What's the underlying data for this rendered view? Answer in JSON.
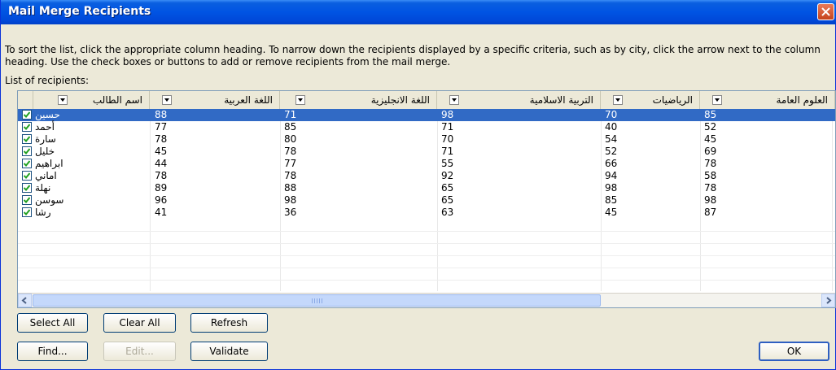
{
  "window": {
    "title": "Mail Merge Recipients"
  },
  "instructions": "To sort the list, click the appropriate column heading.  To narrow down the recipients displayed by a specific criteria, such as by city, click the arrow next to the column heading.  Use the check boxes or buttons to add or remove recipients from the mail merge.",
  "list_label": "List of recipients:",
  "columns": [
    "اسم الطالب",
    "اللغة العربية",
    "اللغة الانجليزية",
    "التربية الاسلامية",
    "الرياضيات",
    "العلوم العامة"
  ],
  "rows": [
    {
      "checked": true,
      "name": "حسين",
      "arabic": "88",
      "english": "71",
      "islamic": "98",
      "math": "70",
      "science": "85"
    },
    {
      "checked": true,
      "name": "أحمد",
      "arabic": "77",
      "english": "85",
      "islamic": "71",
      "math": "40",
      "science": "52"
    },
    {
      "checked": true,
      "name": "سارة",
      "arabic": "78",
      "english": "80",
      "islamic": "70",
      "math": "54",
      "science": "45"
    },
    {
      "checked": true,
      "name": "خليل",
      "arabic": "45",
      "english": "78",
      "islamic": "71",
      "math": "52",
      "science": "69"
    },
    {
      "checked": true,
      "name": "ابراهيم",
      "arabic": "44",
      "english": "77",
      "islamic": "55",
      "math": "66",
      "science": "78"
    },
    {
      "checked": true,
      "name": "اماني",
      "arabic": "78",
      "english": "78",
      "islamic": "92",
      "math": "94",
      "science": "58"
    },
    {
      "checked": true,
      "name": "نهلة",
      "arabic": "89",
      "english": "88",
      "islamic": "65",
      "math": "98",
      "science": "78"
    },
    {
      "checked": true,
      "name": "سوسن",
      "arabic": "96",
      "english": "98",
      "islamic": "65",
      "math": "85",
      "science": "98"
    },
    {
      "checked": true,
      "name": "رشا",
      "arabic": "41",
      "english": "36",
      "islamic": "63",
      "math": "45",
      "science": "87"
    }
  ],
  "buttons": {
    "select_all": "Select All",
    "clear_all": "Clear All",
    "refresh": "Refresh",
    "find": "Find...",
    "edit": "Edit...",
    "validate": "Validate",
    "ok": "OK"
  },
  "colors": {
    "titlebar": "#0054e3",
    "selection": "#316ac5",
    "close": "#c6431c"
  }
}
